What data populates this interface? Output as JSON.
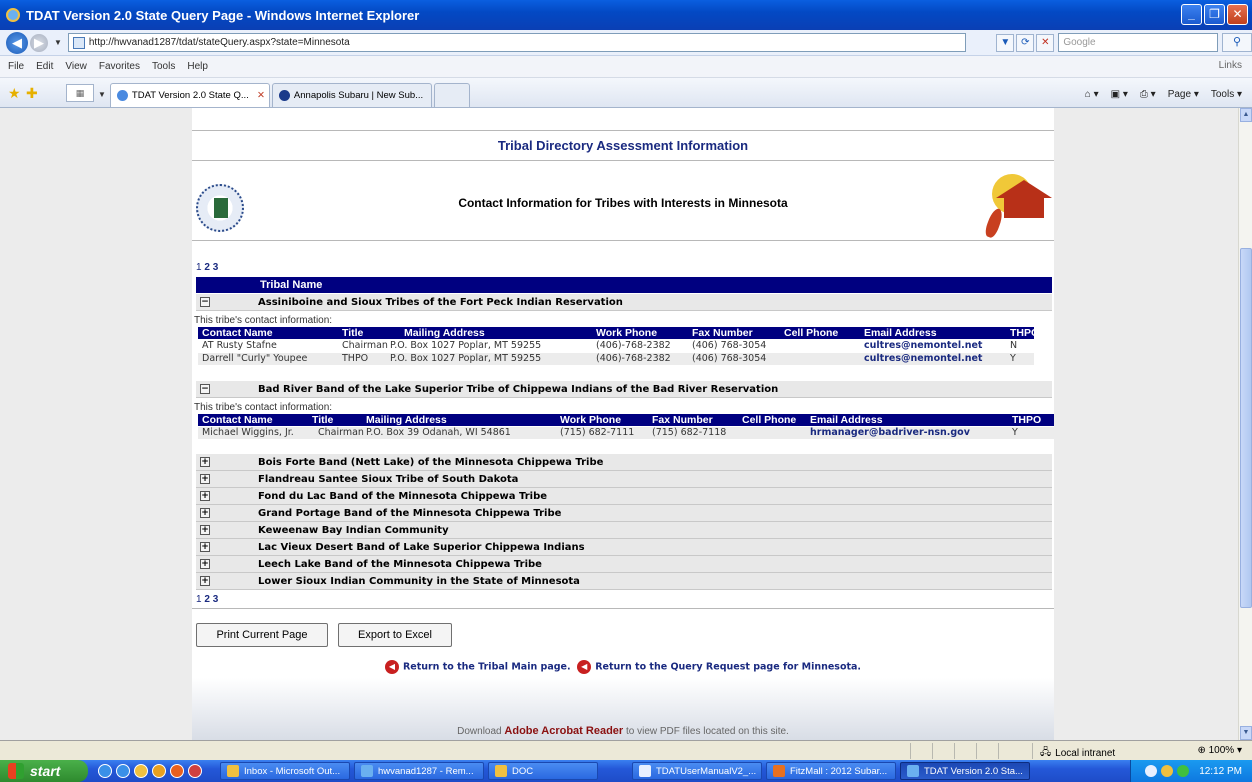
{
  "browser": {
    "window_title": "TDAT Version 2.0 State Query Page - Windows Internet Explorer",
    "url": "http://hwvanad1287/tdat/stateQuery.aspx?state=Minnesota",
    "search_placeholder": "Google",
    "menu": [
      "File",
      "Edit",
      "View",
      "Favorites",
      "Tools",
      "Help"
    ],
    "links_label": "Links",
    "tabs": [
      {
        "label": "TDAT Version 2.0 State Q...",
        "active": true
      },
      {
        "label": "Annapolis Subaru | New Sub...",
        "active": false
      }
    ],
    "command_bar": [
      "Page ▾",
      "Tools ▾"
    ],
    "status_zone": "Local intranet",
    "zoom": "100%"
  },
  "page": {
    "heading": "Tribal Directory Assessment Information",
    "contact_heading": "Contact Information for Tribes with Interests in Minnesota",
    "pager": {
      "current": "1",
      "others": [
        "2",
        "3"
      ]
    },
    "table_header": "Tribal Name",
    "contact_caption": "This tribe's contact information:",
    "contact_columns": [
      "Contact Name",
      "Title",
      "Mailing Address",
      "Work Phone",
      "Fax Number",
      "Cell Phone",
      "Email Address",
      "THPO"
    ],
    "expanded_tribes": [
      {
        "name": "Assiniboine and Sioux Tribes of the Fort Peck Indian Reservation",
        "contacts": [
          {
            "name": "AT Rusty Stafne",
            "title": "Chairman",
            "address": "P.O. Box 1027 Poplar, MT 59255",
            "work": "(406)-768-2382",
            "fax": "(406) 768-3054",
            "cell": "",
            "email": "cultres@nemontel.net",
            "thpo": "N"
          },
          {
            "name": "Darrell \"Curly\" Youpee",
            "title": "THPO",
            "address": "P.O. Box 1027 Poplar, MT 59255",
            "work": "(406)-768-2382",
            "fax": "(406) 768-3054",
            "cell": "",
            "email": "cultres@nemontel.net",
            "thpo": "Y"
          }
        ]
      },
      {
        "name": "Bad River Band of the Lake Superior Tribe of Chippewa Indians of the Bad River Reservation",
        "contacts": [
          {
            "name": "Michael Wiggins, Jr.",
            "title": "Chairman",
            "address": "P.O. Box 39 Odanah, WI 54861",
            "work": "(715) 682-7111",
            "fax": "(715) 682-7118",
            "cell": "",
            "email": "hrmanager@badriver-nsn.gov",
            "thpo": "Y"
          }
        ]
      }
    ],
    "collapsed_tribes": [
      "Bois Forte Band (Nett Lake) of the Minnesota Chippewa Tribe",
      "Flandreau Santee Sioux Tribe of South Dakota",
      "Fond du Lac Band of the Minnesota Chippewa Tribe",
      "Grand Portage Band of the Minnesota Chippewa Tribe",
      "Keweenaw Bay Indian Community",
      "Lac Vieux Desert Band of Lake Superior Chippewa Indians",
      "Leech Lake Band of the Minnesota Chippewa Tribe",
      "Lower Sioux Indian Community in the State of Minnesota"
    ],
    "buttons": {
      "print": "Print Current Page",
      "export": "Export to Excel"
    },
    "return_links": {
      "main": "Return to the Tribal Main page.",
      "query": "Return to the Query Request page for Minnesota."
    },
    "download_note": {
      "prefix": "Download",
      "product": "Adobe Acrobat Reader",
      "suffix": "to view PDF files located on this site."
    }
  },
  "taskbar": {
    "start_label": "start",
    "tasks": [
      {
        "label": "Inbox - Microsoft Out...",
        "active": false
      },
      {
        "label": "hwvanad1287 - Rem...",
        "active": false
      },
      {
        "label": "DOC",
        "active": false
      },
      {
        "label": "TDATUserManualV2_...",
        "active": false
      },
      {
        "label": "FitzMall : 2012 Subar...",
        "active": false
      },
      {
        "label": "TDAT Version 2.0 Sta...",
        "active": true
      }
    ],
    "clock": "12:12 PM"
  }
}
